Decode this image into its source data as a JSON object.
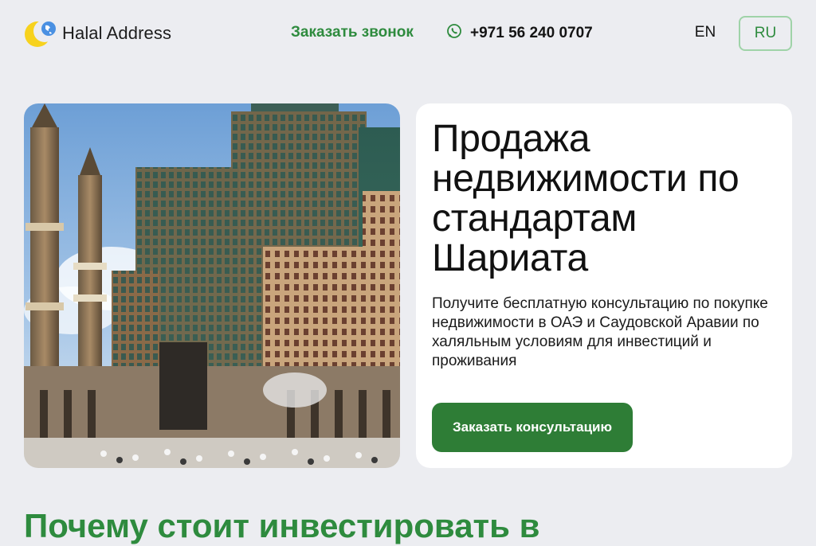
{
  "brand": {
    "name": "Halal Address",
    "logo_icon": "crescent-globe-icon",
    "accent": "#2e8b3e"
  },
  "header": {
    "callback_label": "Заказать звонок",
    "phone": "+971 56 240 0707",
    "phone_icon": "whatsapp-icon",
    "languages": [
      "EN",
      "RU"
    ],
    "active_language": "RU"
  },
  "hero": {
    "image_alt": "mecca-towers-photo",
    "title": "Продажа недвижимости по стандартам Шариата",
    "subtitle": "Получите бесплатную консультацию по покупке недвижимости в ОАЭ и Саудовской Аравии по халяльным условиям для инвестиций и проживания",
    "cta_label": "Заказать консультацию",
    "cta_color": "#2e7d36"
  },
  "section": {
    "title": "Почему стоит инвестировать в"
  }
}
